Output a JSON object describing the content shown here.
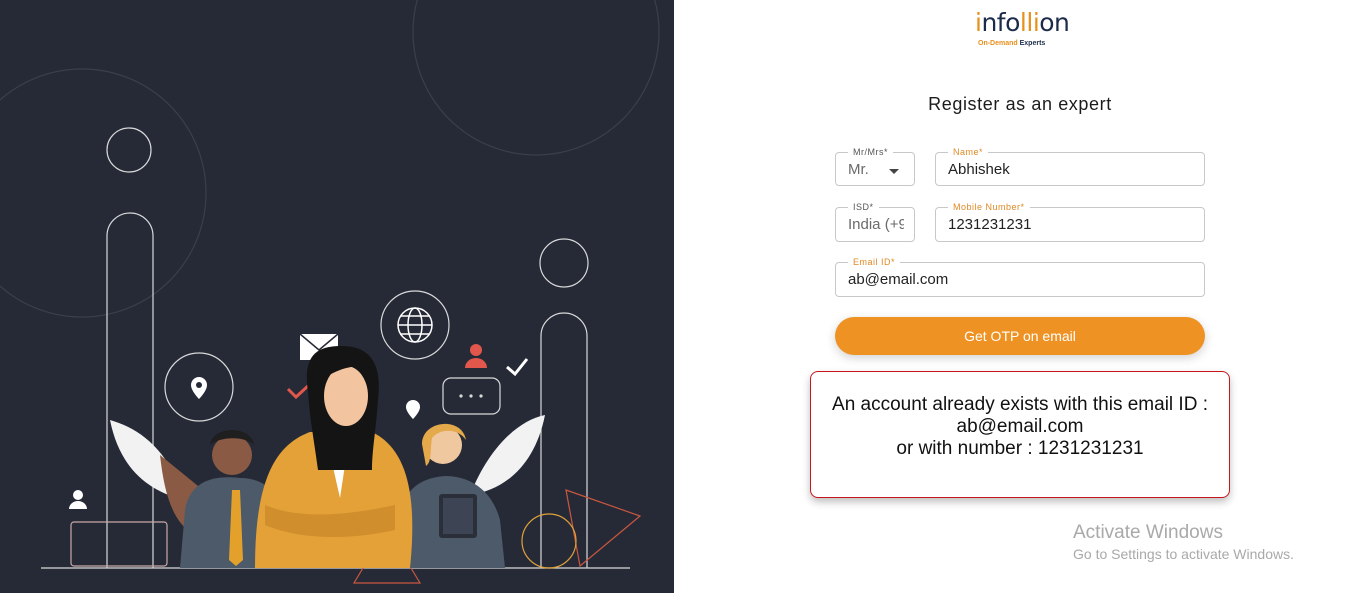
{
  "brand": {
    "logo_letters": [
      "i",
      "nfo",
      "ll",
      "i",
      "on"
    ],
    "tagline_first": "On-Demand",
    "tagline_rest": " Experts"
  },
  "page_title": "Register as an expert",
  "form": {
    "salutation": {
      "label": "Mr/Mrs*",
      "value": "Mr."
    },
    "name": {
      "label": "Name*",
      "value": "Abhishek"
    },
    "isd": {
      "label": "ISD*",
      "value": "India (+9"
    },
    "mobile": {
      "label": "Mobile Number*",
      "value": "1231231231"
    },
    "email": {
      "label": "Email ID*",
      "value": "ab@email.com"
    },
    "submit_label": "Get OTP on email"
  },
  "alert": {
    "line1": "An account already exists with this email ID :",
    "line2": "ab@email.com",
    "line3": "or with number : 1231231231"
  },
  "watermark": {
    "title": "Activate Windows",
    "subtitle": "Go to Settings to activate Windows."
  },
  "colors": {
    "left_panel_bg": "#262a37",
    "accent": "#ee9223",
    "alert_border": "#c4161c",
    "brand_navy": "#1d2b4b"
  },
  "icons": [
    "map-pin-icon",
    "globe-icon",
    "envelope-icon",
    "user-icon",
    "checkmark-icon",
    "chat-bubble-icon",
    "dropdown-caret-icon"
  ]
}
